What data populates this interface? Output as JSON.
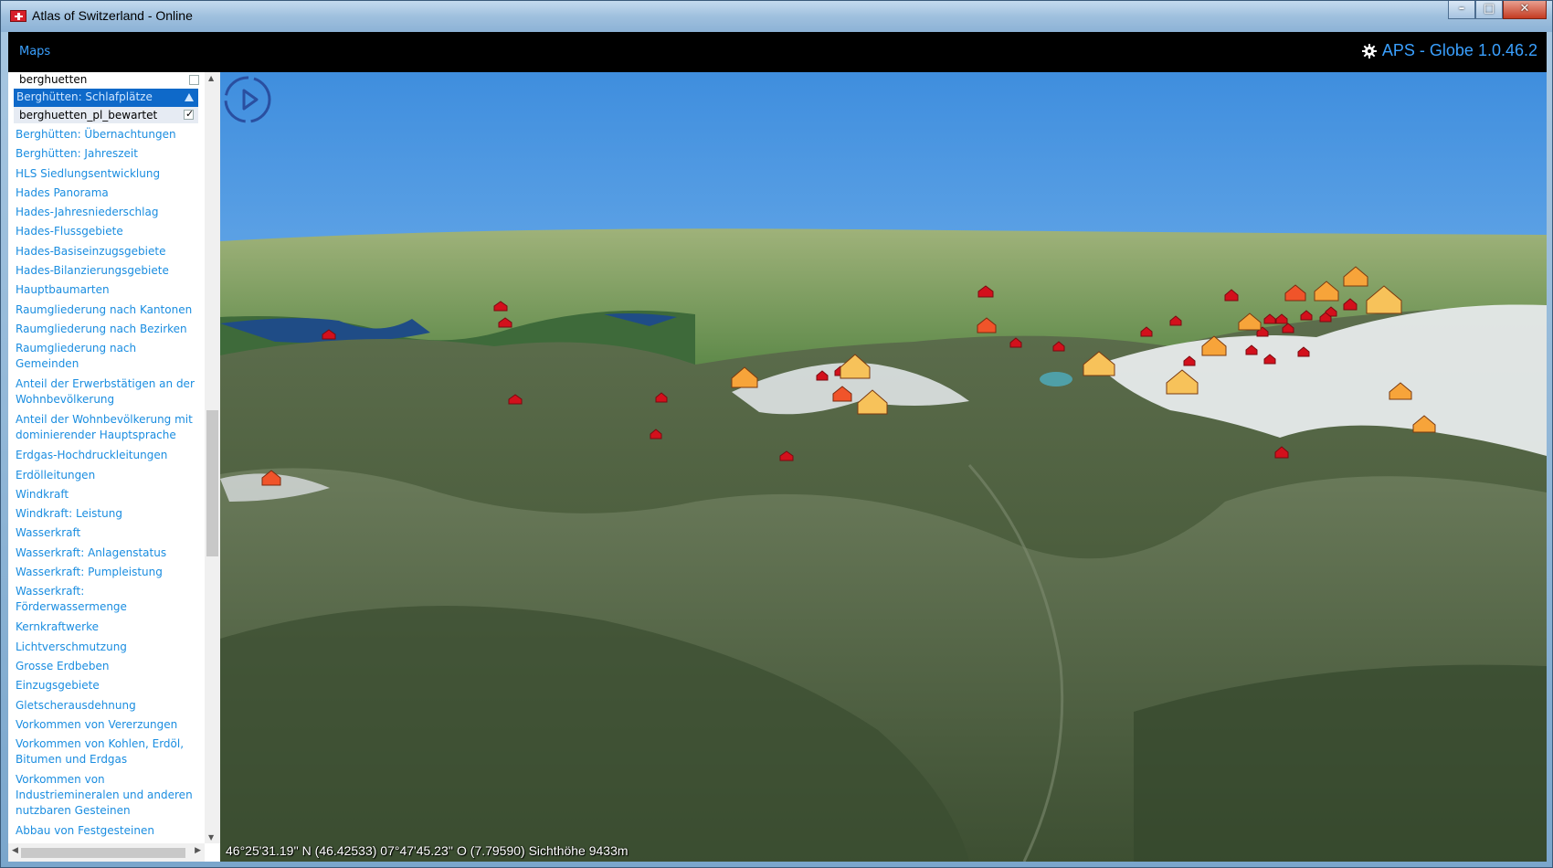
{
  "window": {
    "title": "Atlas of Switzerland - Online"
  },
  "toolbar": {
    "menu_label": "Maps",
    "version": "APS - Globe 1.0.46.2"
  },
  "sidebar": {
    "search_value": "berghuetten",
    "selected_item": "Berghütten: Schlafplätze",
    "sub_item": "berghuetten_pl_bewartet",
    "items": [
      "Berghütten: Übernachtungen",
      "Berghütten: Jahreszeit",
      "HLS Siedlungsentwicklung",
      "Hades Panorama",
      "Hades-Jahresniederschlag",
      "Hades-Flussgebiete",
      "Hades-Basiseinzugsgebiete",
      "Hades-Bilanzierungsgebiete",
      "Hauptbaumarten",
      "Raumgliederung nach Kantonen",
      "Raumgliederung nach Bezirken",
      "Raumgliederung nach Gemeinden",
      "Anteil der Erwerbstätigen an der Wohnbevölkerung",
      "Anteil der Wohnbevölkerung mit dominierender Hauptsprache",
      "Erdgas-Hochdruckleitungen",
      "Erdölleitungen",
      "Windkraft",
      "Windkraft: Leistung",
      "Wasserkraft",
      "Wasserkraft: Anlagenstatus",
      "Wasserkraft: Pumpleistung",
      "Wasserkraft: Förderwassermenge",
      "Kernkraftwerke",
      "Lichtverschmutzung",
      "Grosse Erdbeben",
      "Einzugsgebiete",
      "Gletscherausdehnung",
      "Vorkommen von Vererzungen",
      "Vorkommen von Kohlen, Erdöl, Bitumen und Erdgas",
      "Vorkommen von Industriemineralen und anderen nutzbaren Gesteinen",
      "Abbau von Festgesteinen"
    ]
  },
  "globe": {
    "status": "46°25'31.19'' N (46.42533) 07°47'45.23'' O (7.79590) Sichthöhe 9433m"
  },
  "colors": {
    "accent": "#1a8de0",
    "selection": "#0e69c9",
    "hut_small": "#d3101c",
    "hut_large_fill": "#f7a43a"
  }
}
